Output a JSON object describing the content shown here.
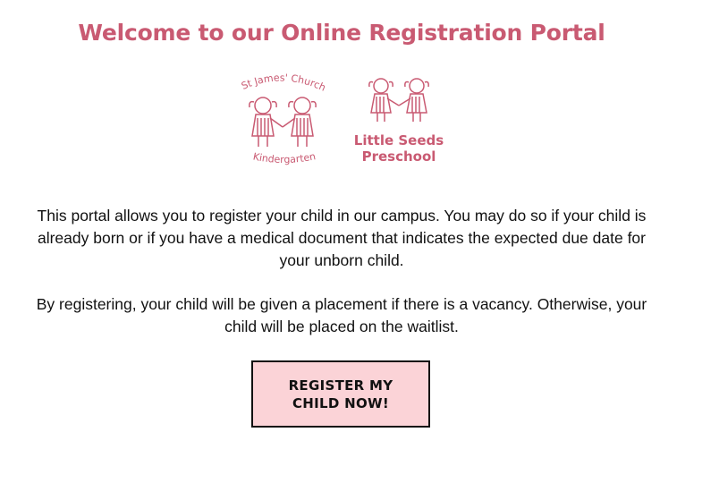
{
  "header": {
    "title": "Welcome to our Online Registration Portal"
  },
  "logos": {
    "kindergarten": {
      "top_text": "St James' Church",
      "bottom_text": "Kindergarten",
      "icon": "two-children-holding-hands-icon"
    },
    "preschool": {
      "line1": "Little Seeds",
      "line2": "Preschool",
      "icon": "two-children-holding-hands-icon"
    }
  },
  "intro": {
    "paragraph1": "This portal allows you to register your child in our campus. You may do so if your child is already born or if you have a medical document that indicates the expected due date for your unborn child.",
    "paragraph2": "By registering, your child will be given a placement if there is a vacancy. Otherwise, your child will be placed on the waitlist."
  },
  "cta": {
    "register_label": "REGISTER MY CHILD NOW!"
  },
  "colors": {
    "brand": "#c95a72",
    "button_bg": "#fbd3d7",
    "text": "#111111"
  }
}
